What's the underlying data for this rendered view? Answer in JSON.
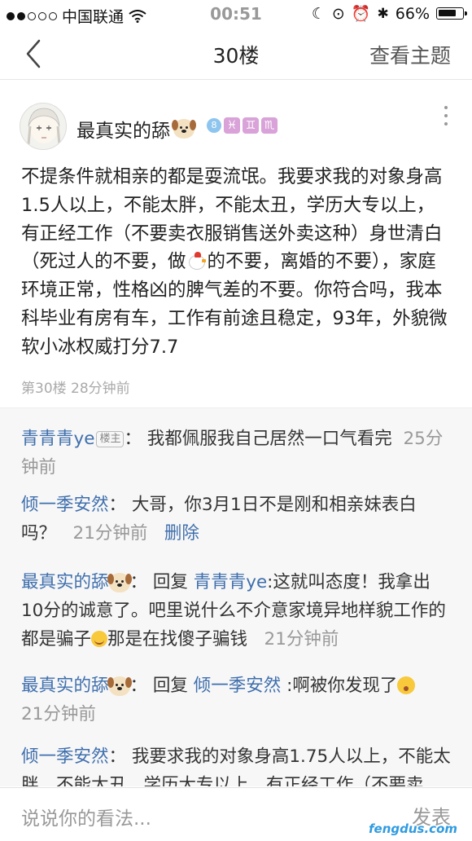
{
  "status_bar": {
    "carrier": "中国联通",
    "time": "00:51",
    "battery": "66%"
  },
  "nav": {
    "title": "30楼",
    "topic_link": "查看主题"
  },
  "post": {
    "author": "最真实的舔",
    "level": "8",
    "zodiac": [
      "♓",
      "♊",
      "♏"
    ],
    "text_before": "不提条件就相亲的都是耍流氓。我要求我的对象身高1.5人以上，不能太胖，不能太丑，学历大专以上，有正经工作（不要卖衣服销售送外卖这种）身世清白（死过人的不要，做",
    "text_after": "的不要，离婚的不要），家庭环境正常，性格凶的脾气差的不要。你符合吗，我本科毕业有房有车，工作有前途且稳定，93年，外貌微软小冰权威打分7.7",
    "meta": "第30楼 28分钟前"
  },
  "comments": [
    {
      "user": "青青青ye",
      "badge": "楼主",
      "text": "：  我都佩服我自己居然一口气看完",
      "time": "25分钟前"
    },
    {
      "user": "倾一季安然",
      "text": "：  大哥，你3月1日不是刚和相亲妹表白吗？",
      "time": "21分钟前",
      "action": "删除"
    },
    {
      "user": "最真实的舔",
      "reply_label": "回复",
      "reply_to": "青青青ye",
      "text": ":这就叫态度！我拿出10分的诚意了。吧里说什么不介意家境异地样貌工作的都是骗子",
      "text_after": "那是在找傻子骗钱",
      "time": "21分钟前"
    },
    {
      "user": "最真实的舔",
      "reply_label": "回复",
      "reply_to": "倾一季安然",
      "text": ":啊被你发现了",
      "time": "21分钟前"
    },
    {
      "user": "倾一季安然",
      "text": "：  我要求我的对象身高1.75人以上，不能太胖，不能太丑，学历大专以上，有正经工作（不要卖"
    }
  ],
  "input_bar": {
    "placeholder": "说说你的看法...",
    "send": "发表"
  },
  "watermark": "fengdus.com"
}
